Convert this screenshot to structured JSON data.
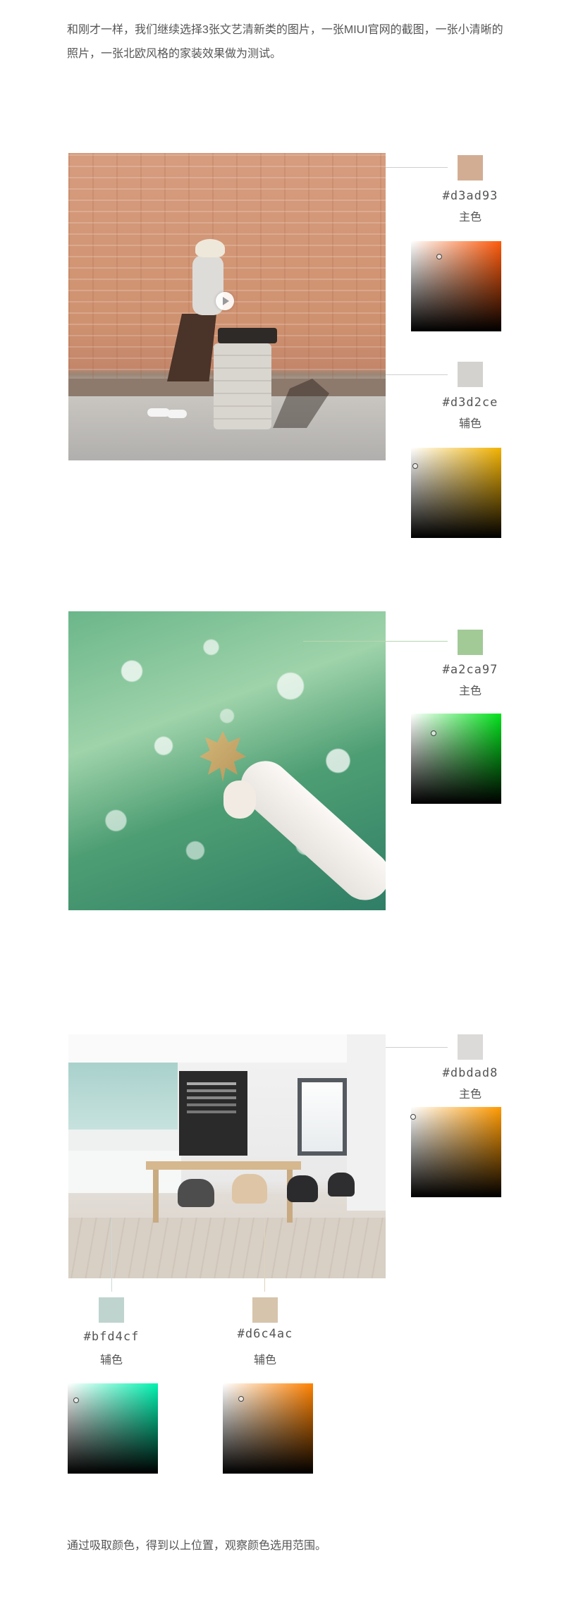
{
  "intro_text": "和刚才一样，我们继续选择3张文艺清新类的图片，一张MIUI官网的截图，一张小清晰的照片，一张北欧风格的家装效果做为测试。",
  "outro_text": "通过吸取颜色，得到以上位置，观察颜色选用范围。",
  "example_1": {
    "primary": {
      "hex": "#d3ad93",
      "role": "主色",
      "swatch_color": "#d3ad93"
    },
    "secondary": {
      "hex": "#d3d2ce",
      "role": "辅色",
      "swatch_color": "#d3d2ce"
    }
  },
  "example_2": {
    "primary": {
      "hex": "#a2ca97",
      "role": "主色",
      "swatch_color": "#a2ca97"
    }
  },
  "example_3": {
    "primary": {
      "hex": "#dbdad8",
      "role": "主色",
      "swatch_color": "#dbdad8"
    },
    "secondary_a": {
      "hex": "#bfd4cf",
      "role": "辅色",
      "swatch_color": "#bfd4cf"
    },
    "secondary_b": {
      "hex": "#d6c4ac",
      "role": "辅色",
      "swatch_color": "#d6c4ac"
    }
  },
  "icons": {
    "play": "play-icon"
  }
}
